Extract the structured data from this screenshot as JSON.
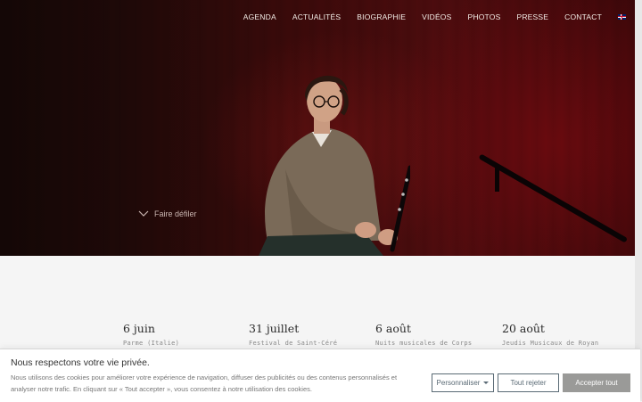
{
  "nav": {
    "items": [
      "AGENDA",
      "ACTUALITÉS",
      "BIOGRAPHIE",
      "VIDÉOS",
      "PHOTOS",
      "PRESSE",
      "CONTACT"
    ],
    "language_icon": "uk-flag-icon"
  },
  "hero": {
    "scroll_label": "Faire défiler"
  },
  "events": [
    {
      "date": "6 juin",
      "place": "Parme (Italie)"
    },
    {
      "date": "31 juillet",
      "place": "Festival de Saint-Céré"
    },
    {
      "date": "6 août",
      "place": "Nuits musicales de Corps"
    },
    {
      "date": "20 août",
      "place": "Jeudis Musicaux de Royan"
    }
  ],
  "cookie": {
    "title": "Nous respectons votre vie privée.",
    "text": "Nous utilisons des cookies pour améliorer votre expérience de navigation, diffuser des publicités ou des contenus personnalisés et analyser notre trafic. En cliquant sur « Tout accepter », vous consentez à notre utilisation des cookies.",
    "customize_label": "Personnaliser",
    "reject_label": "Tout rejeter",
    "accept_label": "Accepter tout"
  },
  "colors": {
    "hero_red": "#4d0c0e",
    "accept_button": "#9a9a98",
    "outline_button": "#5a6a75"
  }
}
